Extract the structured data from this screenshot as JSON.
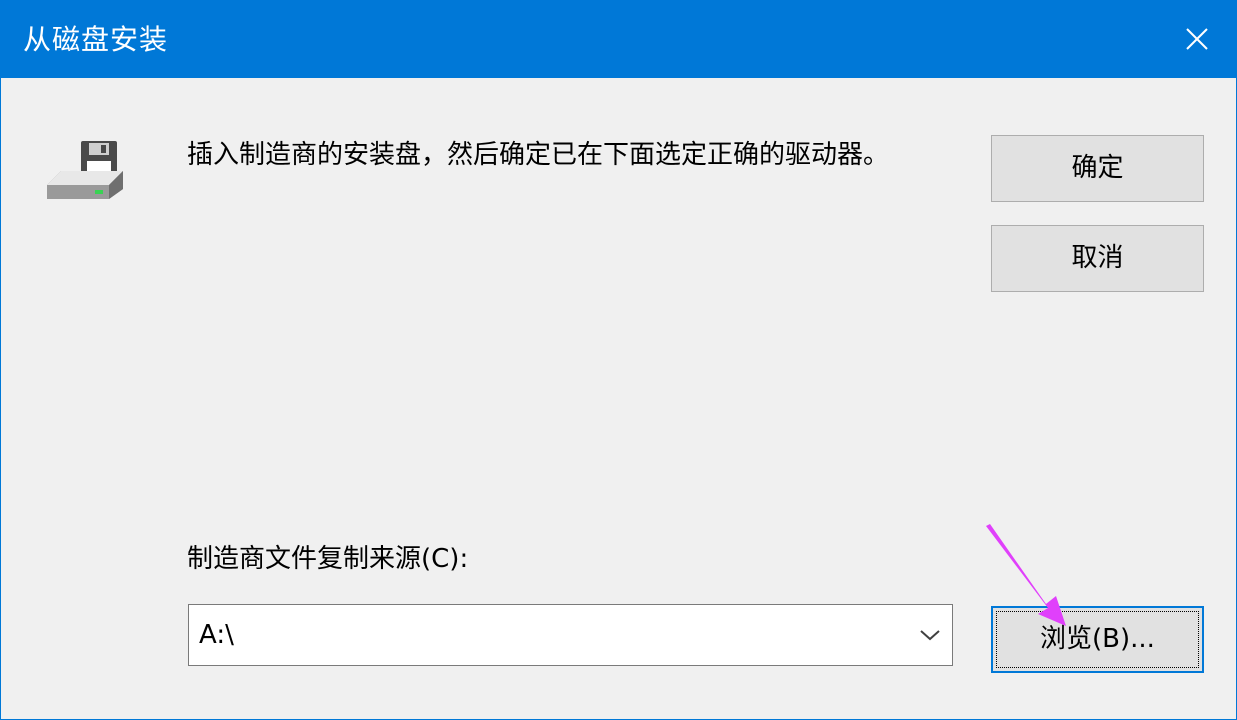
{
  "window": {
    "title": "从磁盘安装",
    "close_icon": "close-icon"
  },
  "message": "插入制造商的安装盘，然后确定已在下面选定正确的驱动器。",
  "buttons": {
    "ok": "确定",
    "cancel": "取消",
    "browse": "浏览(B)..."
  },
  "source": {
    "label": "制造商文件复制来源(C):",
    "value": "A:\\"
  },
  "colors": {
    "titlebar": "#0078d7",
    "annotation_arrow": "#e040fb"
  }
}
